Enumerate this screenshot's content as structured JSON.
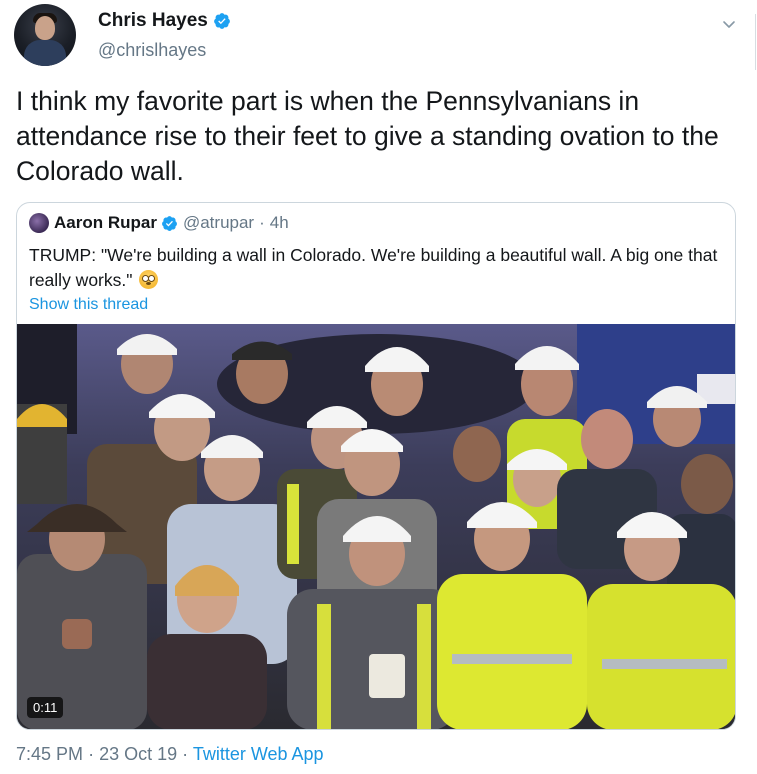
{
  "tweet": {
    "display_name": "Chris Hayes",
    "handle": "@chrislhayes",
    "verified_icon": "verified-badge-icon",
    "text": "I think my favorite part is when the Pennsylvanians in attendance rise to their feet to give a standing ovation to the Colorado wall.",
    "menu_icon": "chevron-down-icon"
  },
  "quoted_tweet": {
    "display_name": "Aaron Rupar",
    "handle": "@atrupar",
    "separator": "·",
    "time": "4h",
    "text": "TRUMP: \"We're building a wall in Colorado. We're building a beautiful wall. A big one that really works.\"",
    "emoji": "flushed-face-emoji",
    "show_thread": "Show this thread",
    "video": {
      "duration": "0:11",
      "description_icon": "crowd-video-thumbnail"
    }
  },
  "footer": {
    "time": "7:45 PM",
    "sep1": "·",
    "date": "23 Oct 19",
    "sep2": "·",
    "source": "Twitter Web App"
  },
  "colors": {
    "link": "#1b95e0",
    "secondary_text": "#657786",
    "verified": "#1da1f2",
    "border": "#ccd6dd"
  }
}
